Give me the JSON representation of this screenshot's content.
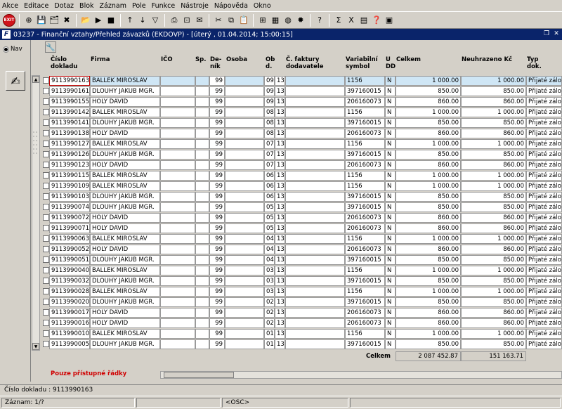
{
  "menu": [
    "Akce",
    "Editace",
    "Dotaz",
    "Blok",
    "Záznam",
    "Pole",
    "Funkce",
    "Nástroje",
    "Nápověda",
    "Okno"
  ],
  "toolbar": {
    "exit_label": "EXIT",
    "icons": [
      "new-record-icon",
      "save-icon",
      "save-all-icon",
      "delete-icon",
      "query-icon",
      "execute-query-icon",
      "cancel-query-icon",
      "sort-asc-icon",
      "sort-desc-icon",
      "filter-icon",
      "print-icon",
      "print-preview-icon",
      "email-icon",
      "cut-icon",
      "copy-icon",
      "paste-icon",
      "attach-icon",
      "calculator-icon",
      "globe-icon",
      "sun-icon",
      "help-icon",
      "sum-icon",
      "excel-icon",
      "grid-icon",
      "help-book-icon",
      "chart-icon"
    ]
  },
  "window": {
    "title": "03237 - Finanční vztahy/Přehled závazků (EKDOVP) - [úterý , 01.04.2014; 15:00:15]",
    "logo": "F"
  },
  "left_panel": {
    "nav_label": "Nav"
  },
  "columns": {
    "doklad": "Číslo\ndokladu",
    "firma": "Firma",
    "ico": "IČO",
    "sp": "Sp.",
    "denik": "De-\nník",
    "osoba": "Osoba",
    "obd": "Ob\nd.",
    "fakt": "Č. faktury\ndodavatele",
    "var": "Variabilní\nsymbol",
    "udd": "U\nDD",
    "celk": "Celkem",
    "neuh": "Neuhrazeno Kč",
    "typ": "Typ\ndok."
  },
  "rows": [
    {
      "doklad": "9113990163",
      "firma": "BALLEK MIROSLAV",
      "denik": "99",
      "obd": "09",
      "x": "13",
      "var": "1156",
      "udd": "N",
      "celk": "1 000.00",
      "neuh": "1 000.00",
      "typ": "Přijaté zálohy"
    },
    {
      "doklad": "9113990161",
      "firma": "DLOUHY JAKUB MGR.",
      "denik": "99",
      "obd": "09",
      "x": "13",
      "var": "397160015",
      "udd": "N",
      "celk": "850.00",
      "neuh": "850.00",
      "typ": "Přijaté zálohy"
    },
    {
      "doklad": "9113990155",
      "firma": "HOLY DAVID",
      "denik": "99",
      "obd": "09",
      "x": "13",
      "var": "206160073",
      "udd": "N",
      "celk": "860.00",
      "neuh": "860.00",
      "typ": "Přijaté zálohy"
    },
    {
      "doklad": "9113990142",
      "firma": "BALLEK MIROSLAV",
      "denik": "99",
      "obd": "08",
      "x": "13",
      "var": "1156",
      "udd": "N",
      "celk": "1 000.00",
      "neuh": "1 000.00",
      "typ": "Přijaté zálohy"
    },
    {
      "doklad": "9113990141",
      "firma": "DLOUHY JAKUB MGR.",
      "denik": "99",
      "obd": "08",
      "x": "13",
      "var": "397160015",
      "udd": "N",
      "celk": "850.00",
      "neuh": "850.00",
      "typ": "Přijaté zálohy"
    },
    {
      "doklad": "9113990138",
      "firma": "HOLY DAVID",
      "denik": "99",
      "obd": "08",
      "x": "13",
      "var": "206160073",
      "udd": "N",
      "celk": "860.00",
      "neuh": "860.00",
      "typ": "Přijaté zálohy"
    },
    {
      "doklad": "9113990127",
      "firma": "BALLEK MIROSLAV",
      "denik": "99",
      "obd": "07",
      "x": "13",
      "var": "1156",
      "udd": "N",
      "celk": "1 000.00",
      "neuh": "1 000.00",
      "typ": "Přijaté zálohy"
    },
    {
      "doklad": "9113990126",
      "firma": "DLOUHY JAKUB MGR.",
      "denik": "99",
      "obd": "07",
      "x": "13",
      "var": "397160015",
      "udd": "N",
      "celk": "850.00",
      "neuh": "850.00",
      "typ": "Přijaté zálohy"
    },
    {
      "doklad": "9113990123",
      "firma": "HOLY DAVID",
      "denik": "99",
      "obd": "07",
      "x": "13",
      "var": "206160073",
      "udd": "N",
      "celk": "860.00",
      "neuh": "860.00",
      "typ": "Přijaté zálohy"
    },
    {
      "doklad": "9113990115",
      "firma": "BALLEK MIROSLAV",
      "denik": "99",
      "obd": "06",
      "x": "13",
      "var": "1156",
      "udd": "N",
      "celk": "1 000.00",
      "neuh": "1 000.00",
      "typ": "Přijaté zálohy"
    },
    {
      "doklad": "9113990109",
      "firma": "BALLEK MIROSLAV",
      "denik": "99",
      "obd": "06",
      "x": "13",
      "var": "1156",
      "udd": "N",
      "celk": "1 000.00",
      "neuh": "1 000.00",
      "typ": "Přijaté zálohy"
    },
    {
      "doklad": "9113990103",
      "firma": "DLOUHY JAKUB MGR.",
      "denik": "99",
      "obd": "06",
      "x": "13",
      "var": "397160015",
      "udd": "N",
      "celk": "850.00",
      "neuh": "850.00",
      "typ": "Přijaté zálohy"
    },
    {
      "doklad": "9113990074",
      "firma": "DLOUHY JAKUB MGR.",
      "denik": "99",
      "obd": "05",
      "x": "13",
      "var": "397160015",
      "udd": "N",
      "celk": "850.00",
      "neuh": "850.00",
      "typ": "Přijaté zálohy"
    },
    {
      "doklad": "9113990072",
      "firma": "HOLY DAVID",
      "denik": "99",
      "obd": "05",
      "x": "13",
      "var": "206160073",
      "udd": "N",
      "celk": "860.00",
      "neuh": "860.00",
      "typ": "Přijaté zálohy"
    },
    {
      "doklad": "9113990071",
      "firma": "HOLY DAVID",
      "denik": "99",
      "obd": "05",
      "x": "13",
      "var": "206160073",
      "udd": "N",
      "celk": "860.00",
      "neuh": "860.00",
      "typ": "Přijaté zálohy"
    },
    {
      "doklad": "9113990063",
      "firma": "BALLEK MIROSLAV",
      "denik": "99",
      "obd": "04",
      "x": "13",
      "var": "1156",
      "udd": "N",
      "celk": "1 000.00",
      "neuh": "1 000.00",
      "typ": "Přijaté zálohy"
    },
    {
      "doklad": "9113990052",
      "firma": "HOLY DAVID",
      "denik": "99",
      "obd": "04",
      "x": "13",
      "var": "206160073",
      "udd": "N",
      "celk": "860.00",
      "neuh": "860.00",
      "typ": "Přijaté zálohy"
    },
    {
      "doklad": "9113990051",
      "firma": "DLOUHY JAKUB MGR.",
      "denik": "99",
      "obd": "04",
      "x": "13",
      "var": "397160015",
      "udd": "N",
      "celk": "850.00",
      "neuh": "850.00",
      "typ": "Přijaté zálohy"
    },
    {
      "doklad": "9113990040",
      "firma": "BALLEK MIROSLAV",
      "denik": "99",
      "obd": "03",
      "x": "13",
      "var": "1156",
      "udd": "N",
      "celk": "1 000.00",
      "neuh": "1 000.00",
      "typ": "Přijaté zálohy"
    },
    {
      "doklad": "9113990032",
      "firma": "DLOUHY JAKUB MGR.",
      "denik": "99",
      "obd": "03",
      "x": "13",
      "var": "397160015",
      "udd": "N",
      "celk": "850.00",
      "neuh": "850.00",
      "typ": "Přijaté zálohy"
    },
    {
      "doklad": "9113990028",
      "firma": "BALLEK MIROSLAV",
      "denik": "99",
      "obd": "03",
      "x": "13",
      "var": "1156",
      "udd": "N",
      "celk": "1 000.00",
      "neuh": "1 000.00",
      "typ": "Přijaté zálohy"
    },
    {
      "doklad": "9113990020",
      "firma": "DLOUHY JAKUB MGR.",
      "denik": "99",
      "obd": "02",
      "x": "13",
      "var": "397160015",
      "udd": "N",
      "celk": "850.00",
      "neuh": "850.00",
      "typ": "Přijaté zálohy"
    },
    {
      "doklad": "9113990017",
      "firma": "HOLY DAVID",
      "denik": "99",
      "obd": "02",
      "x": "13",
      "var": "206160073",
      "udd": "N",
      "celk": "860.00",
      "neuh": "860.00",
      "typ": "Přijaté zálohy"
    },
    {
      "doklad": "9113990016",
      "firma": "HOLY DAVID",
      "denik": "99",
      "obd": "02",
      "x": "13",
      "var": "206160073",
      "udd": "N",
      "celk": "860.00",
      "neuh": "860.00",
      "typ": "Přijaté zálohy"
    },
    {
      "doklad": "9113990010",
      "firma": "BALLEK MIROSLAV",
      "denik": "99",
      "obd": "01",
      "x": "13",
      "var": "1156",
      "udd": "N",
      "celk": "1 000.00",
      "neuh": "1 000.00",
      "typ": "Přijaté zálohy"
    },
    {
      "doklad": "9113990005",
      "firma": "DLOUHY JAKUB MGR.",
      "denik": "99",
      "obd": "01",
      "x": "13",
      "var": "397160015",
      "udd": "N",
      "celk": "850.00",
      "neuh": "850.00",
      "typ": "Přijaté zálohy"
    }
  ],
  "totals": {
    "label": "Celkem",
    "celkem": "2 087 452.87",
    "neuhrazeno": "151 163.71"
  },
  "access_note": "Pouze přístupné řádky",
  "status": {
    "field": "Číslo dokladu : 9113990163",
    "record": "Záznam: 1/?",
    "mode": "<OSC>"
  }
}
